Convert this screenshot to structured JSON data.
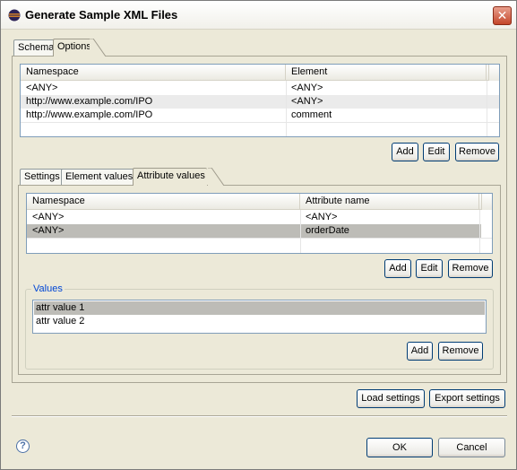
{
  "window": {
    "title": "Generate Sample XML Files",
    "close_glyph": "✕"
  },
  "outer_tabs": [
    {
      "label": "Schema",
      "active": false
    },
    {
      "label": "Options",
      "active": true
    }
  ],
  "elements_table": {
    "headers": [
      "Namespace",
      "Element"
    ],
    "rows": [
      [
        "<ANY>",
        "<ANY>"
      ],
      [
        "http://www.example.com/IPO",
        "<ANY>"
      ],
      [
        "http://www.example.com/IPO",
        "comment"
      ]
    ],
    "buttons": {
      "add": "Add",
      "edit": "Edit",
      "remove": "Remove"
    }
  },
  "inner_tabs": [
    {
      "label": "Settings",
      "active": false
    },
    {
      "label": "Element values",
      "active": false
    },
    {
      "label": "Attribute values",
      "active": true
    }
  ],
  "attributes_table": {
    "headers": [
      "Namespace",
      "Attribute name"
    ],
    "rows": [
      [
        "<ANY>",
        "<ANY>"
      ],
      [
        "<ANY>",
        "orderDate"
      ]
    ],
    "selected_row": 1,
    "buttons": {
      "add": "Add",
      "edit": "Edit",
      "remove": "Remove"
    }
  },
  "values_group": {
    "label": "Values",
    "items": [
      "attr value 1",
      "attr value 2"
    ],
    "selected_item": 0,
    "buttons": {
      "add": "Add",
      "remove": "Remove"
    }
  },
  "settings_buttons": {
    "load": "Load settings",
    "export": "Export settings"
  },
  "footer": {
    "help_glyph": "?",
    "ok": "OK",
    "cancel": "Cancel"
  },
  "colors": {
    "accent": "#0046d5",
    "selection": "#bdbcb7",
    "close": "#c4462a"
  },
  "icons": [
    "eclipse-logo-icon",
    "close-icon",
    "help-icon"
  ]
}
